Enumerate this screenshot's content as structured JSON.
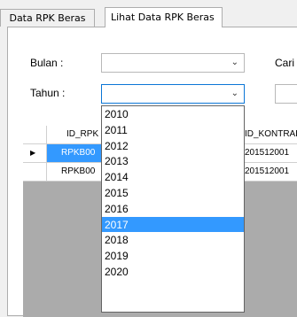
{
  "tabs": [
    {
      "label": "Data RPK Beras",
      "active": false
    },
    {
      "label": "Lihat Data RPK Beras",
      "active": true
    }
  ],
  "form": {
    "bulan_label": "Bulan :",
    "bulan_value": "",
    "tahun_label": "Tahun :",
    "tahun_value": "",
    "cari_label": "Cari",
    "cari_value": ""
  },
  "grid": {
    "columns": [
      "ID_RPK",
      "ID_KONTRAK"
    ],
    "rows": [
      {
        "id_rpk": "RPKB00",
        "id_kontrak": "201512001",
        "selected": true
      },
      {
        "id_rpk": "RPKB00",
        "id_kontrak": "201512001",
        "selected": false
      }
    ]
  },
  "dropdown": {
    "options": [
      "2010",
      "2011",
      "2012",
      "2013",
      "2014",
      "2015",
      "2016",
      "2017",
      "2018",
      "2019",
      "2020"
    ],
    "highlighted": "2017"
  },
  "icons": {
    "combo_arrow": "chevron-down-icon",
    "row_marker": "current-row-icon"
  },
  "colors": {
    "selection": "#3399ff",
    "focus_border": "#0b76d6",
    "grid_background": "#ababab"
  }
}
